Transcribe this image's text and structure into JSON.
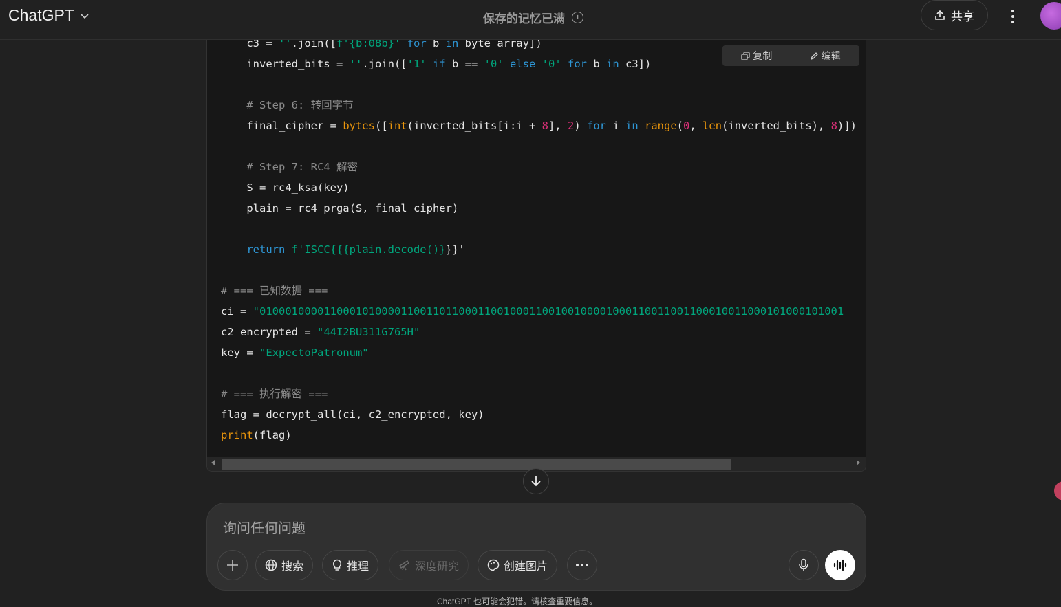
{
  "header": {
    "app_title": "ChatGPT",
    "center_title": "保存的记忆已满",
    "share_label": "共享"
  },
  "code_toolbar": {
    "copy_label": "复制",
    "edit_label": "编辑"
  },
  "code_lines": [
    "    c3 = ''.join([f'{b:08b}' for b in byte_array])",
    "    inverted_bits = ''.join(['1' if b == '0' else '0' for b in c3])",
    "",
    "    # Step 6: 转回字节",
    "    final_cipher = bytes([int(inverted_bits[i:i + 8], 2) for i in range(0, len(inverted_bits), 8)])",
    "",
    "    # Step 7: RC4 解密",
    "    S = rc4_ksa(key)",
    "    plain = rc4_prga(S, final_cipher)",
    "",
    "    return f'ISCC{{{plain.decode()}}}'",
    "",
    "# === 已知数据 ===",
    "ci = \"0100010000110001010000110011011000110010001100100100001000110011001100010011000101000101001",
    "c2_encrypted = \"44I2BU311G765H\"",
    "key = \"ExpectoPatronum\"",
    "",
    "# === 执行解密 ===",
    "flag = decrypt_all(ci, c2_encrypted, key)",
    "print(flag)"
  ],
  "composer": {
    "placeholder": "询问任何问题",
    "tools": {
      "search": "搜索",
      "reason": "推理",
      "deep_research": "深度研究",
      "create_image": "创建图片"
    }
  },
  "footer_text": "ChatGPT 也可能会犯错。请核查重要信息。",
  "colors": {
    "background": "#212121",
    "code_background": "#171717",
    "keyword": "#2e95d3",
    "string": "#00a67d",
    "number": "#df3079",
    "builtin": "#e9950c",
    "comment": "#8a8a8a"
  }
}
